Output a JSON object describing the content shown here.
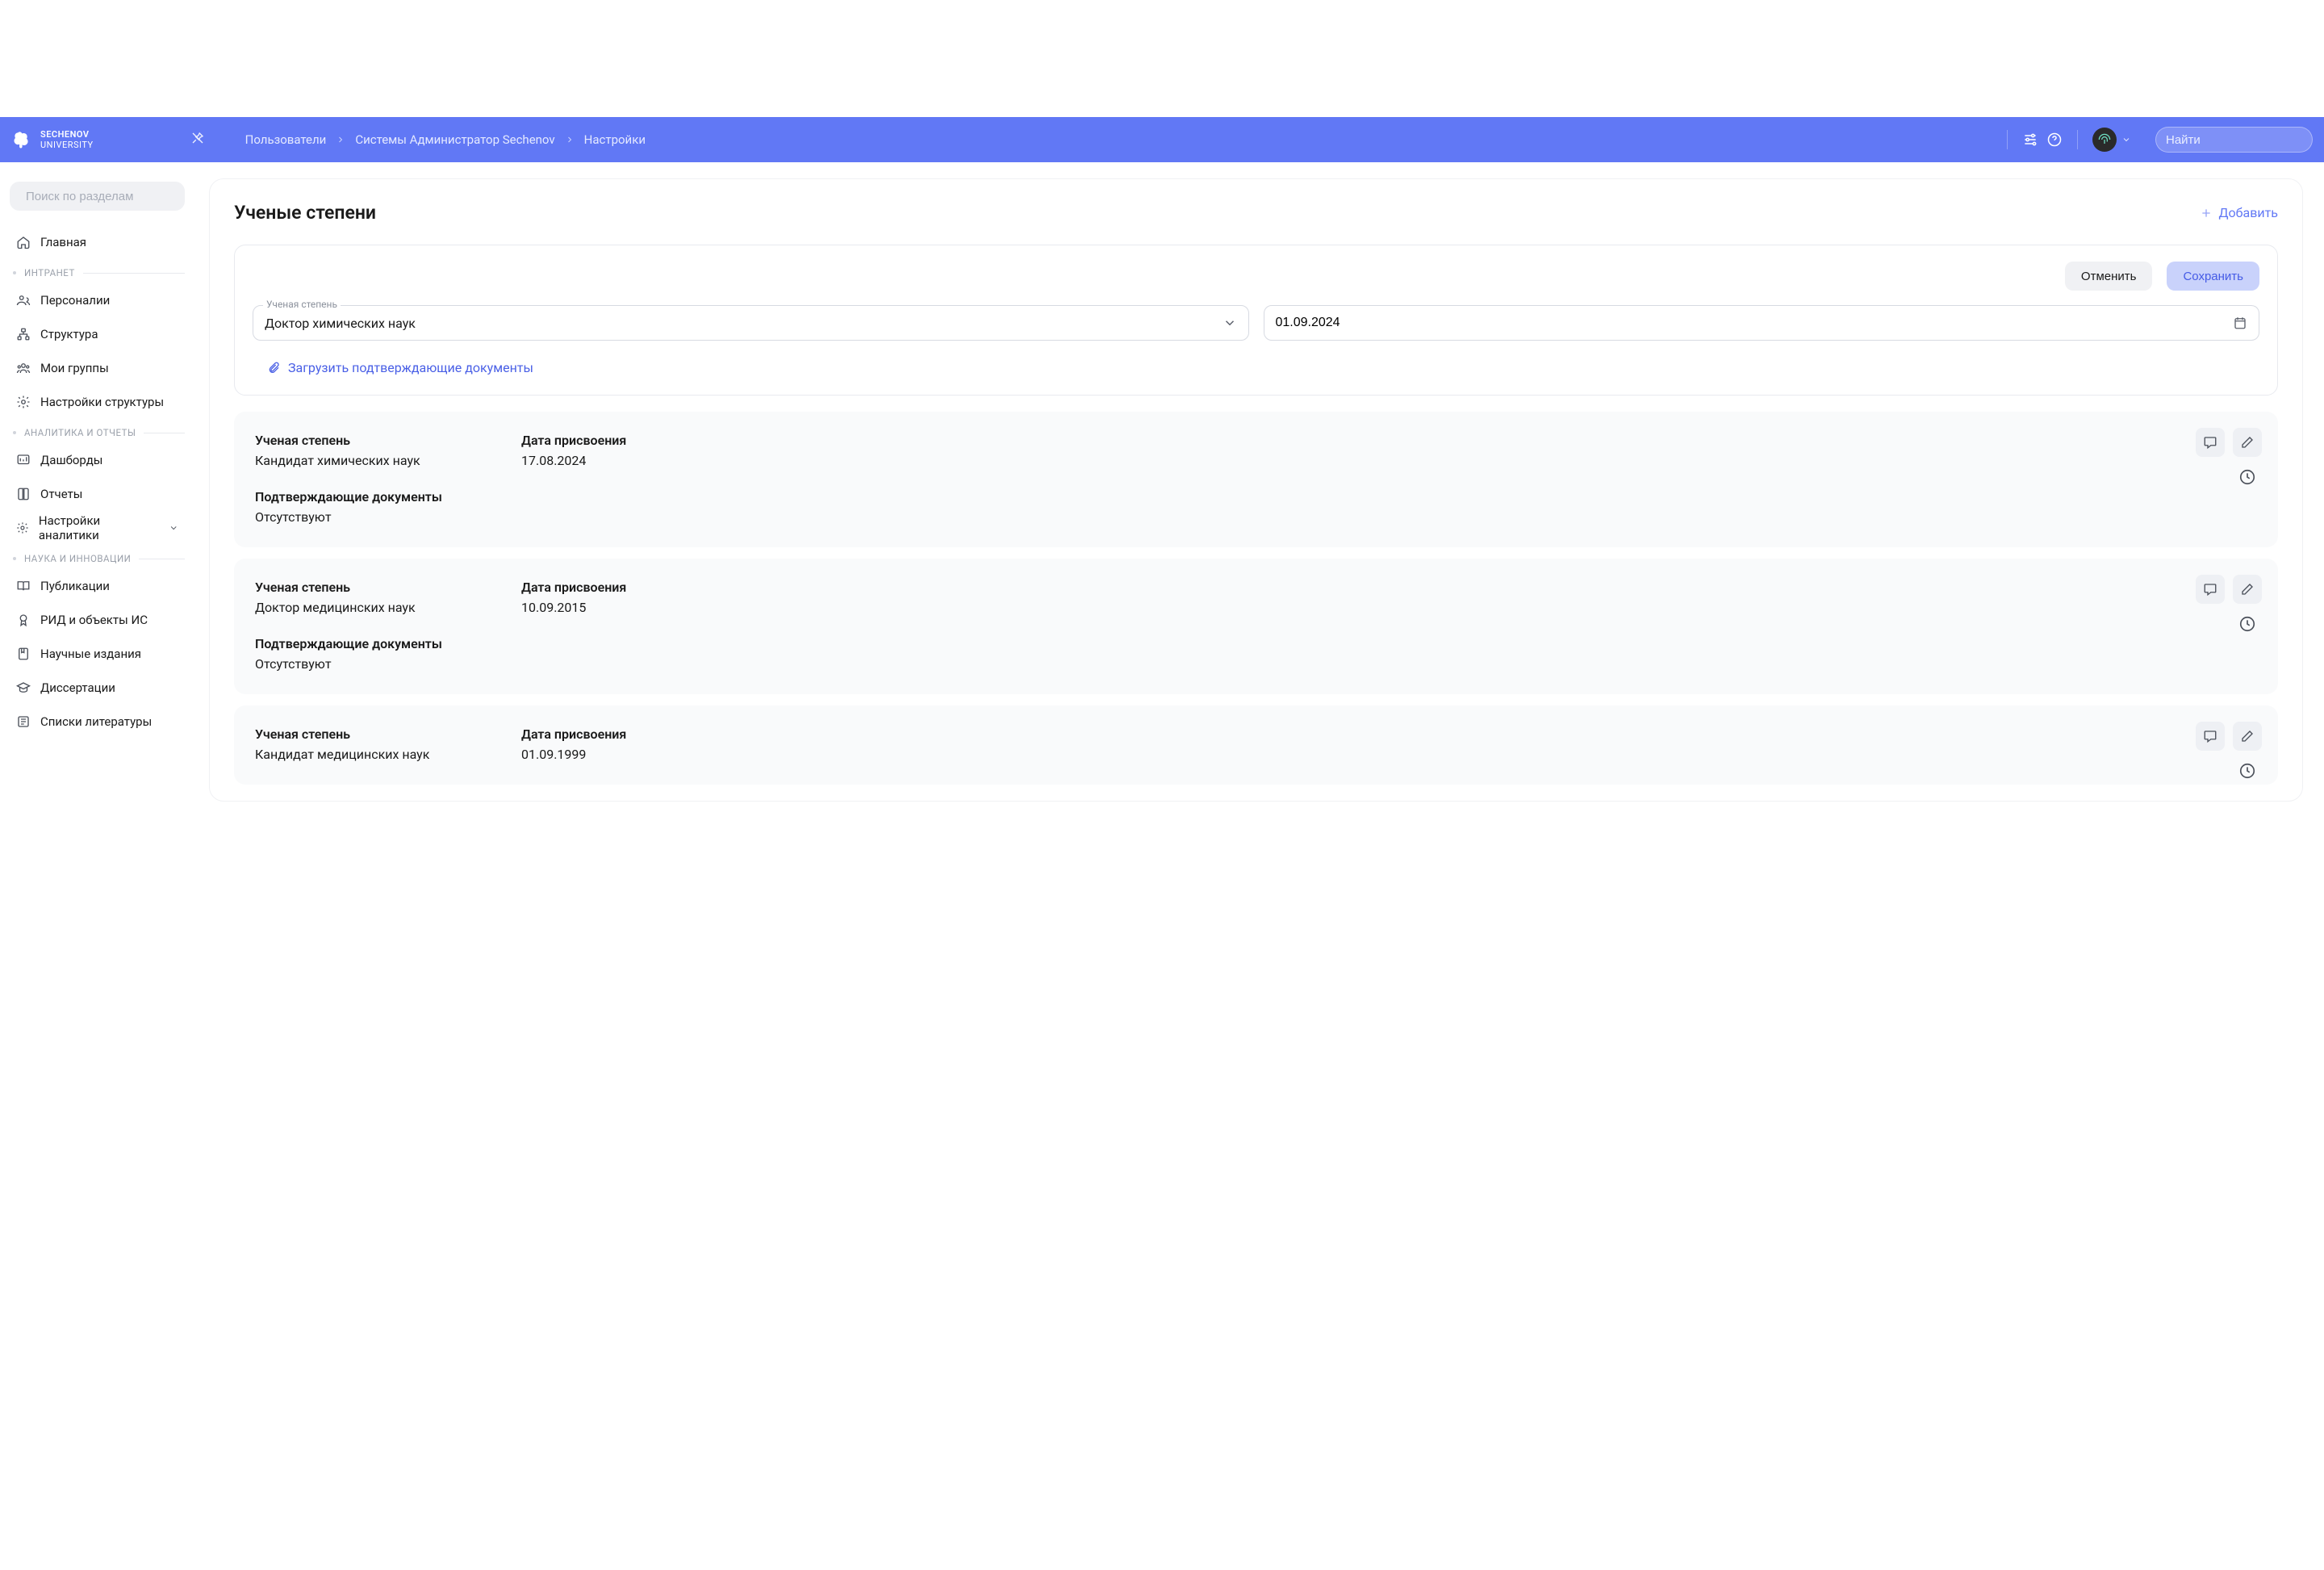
{
  "header": {
    "brand_line1": "SECHENOV",
    "brand_line2": "UNIVERSITY",
    "breadcrumb": [
      "Пользователи",
      "Системы Администратор Sechenov",
      "Настройки"
    ],
    "search_placeholder": "Найти"
  },
  "sidebar": {
    "search_placeholder": "Поиск по разделам",
    "items": [
      {
        "label": "Главная"
      }
    ],
    "section_intranet": "ИНТРАНЕТ",
    "intranet_items": [
      {
        "label": "Персоналии"
      },
      {
        "label": "Структура"
      },
      {
        "label": "Мои группы"
      },
      {
        "label": "Настройки структуры"
      }
    ],
    "section_analytics": "АНАЛИТИКА И ОТЧЕТЫ",
    "analytics_items": [
      {
        "label": "Дашборды"
      },
      {
        "label": "Отчеты"
      },
      {
        "label": "Настройки аналитики",
        "has_caret": true
      }
    ],
    "section_science": "НАУКА И ИННОВАЦИИ",
    "science_items": [
      {
        "label": "Публикации"
      },
      {
        "label": "РИД и объекты ИС"
      },
      {
        "label": "Научные издания"
      },
      {
        "label": "Диссертации"
      },
      {
        "label": "Списки литературы"
      }
    ]
  },
  "main": {
    "title": "Ученые степени",
    "add_btn": "Добавить",
    "edit_panel": {
      "cancel": "Отменить",
      "save": "Сохранить",
      "degree_label": "Ученая степень",
      "degree_value": "Доктор химических наук",
      "date_value": "01.09.2024",
      "upload": "Загрузить подтверждающие документы"
    },
    "labels": {
      "degree": "Ученая степень",
      "date": "Дата присвоения",
      "docs": "Подтверждающие документы",
      "none": "Отсутствуют"
    },
    "records": [
      {
        "degree": "Кандидат химических наук",
        "date": "17.08.2024",
        "docs": "Отсутствуют"
      },
      {
        "degree": "Доктор медицинских наук",
        "date": "10.09.2015",
        "docs": "Отсутствуют"
      },
      {
        "degree": "Кандидат медицинских наук",
        "date": "01.09.1999"
      }
    ]
  }
}
